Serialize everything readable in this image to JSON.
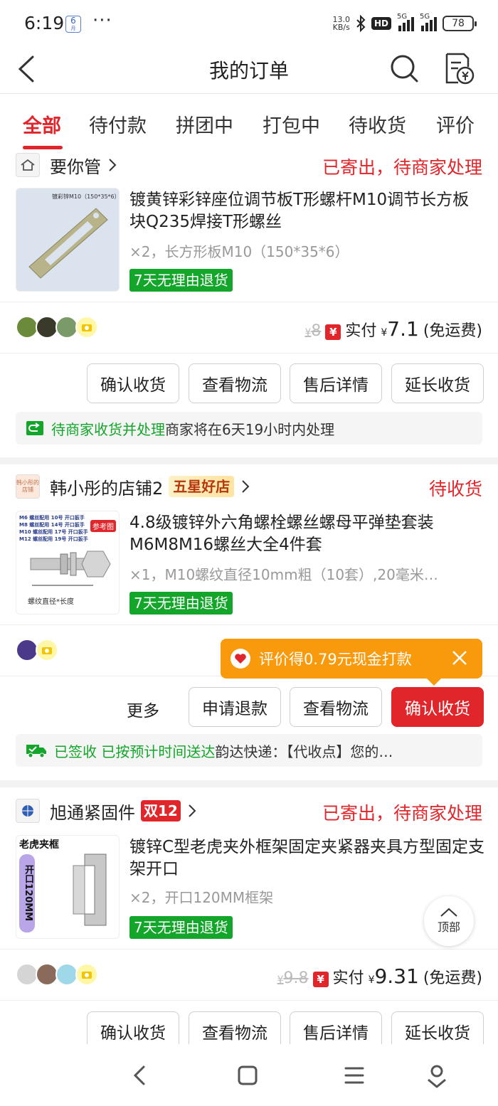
{
  "status_bar": {
    "time": "6:19",
    "badge_num": "6",
    "badge_sub": "月",
    "dots": "···",
    "net_speed_value": "13.0",
    "net_speed_unit": "KB/s",
    "hd": "HD",
    "net1": "5G",
    "net2": "5G",
    "battery": "78"
  },
  "header": {
    "title": "我的订单"
  },
  "tabs": [
    "全部",
    "待付款",
    "拼团中",
    "打包中",
    "待收货",
    "评价"
  ],
  "orders": [
    {
      "shop_name": "要你管",
      "shop_logo_text": "要你管",
      "status": "已寄出，待商家处理",
      "thumb_caption": "镀彩锌M10（150*35*6）",
      "product_title": "镀黄锌彩锌座位调节板T形螺杆M10调节长方板块Q235焊接T形螺丝",
      "spec": "×2，长方形板M10（150*35*6）",
      "return_badge": "7天无理由退货",
      "price_orig_symbol": "¥",
      "price_orig": "8",
      "paid_label": "实付",
      "paid_symbol": "¥",
      "paid_amount": "7.1",
      "shipping": "(免运费)",
      "buttons": [
        "确认收货",
        "查看物流",
        "售后详情",
        "延长收货"
      ],
      "notice_green": "待商家收货并处理",
      "notice_text": " 商家将在6天19小时内处理"
    },
    {
      "shop_name": "韩小彤的店铺2",
      "shop_logo_text": "韩小彤的店铺",
      "shop_tag": "五星好店",
      "status": "待收货",
      "thumb_tag": "参考图",
      "thumb_lines": [
        "M6 螺丝配用 10号 开口扳手",
        "M8 螺丝配用 14号 开口扳手",
        "M10 螺丝配用 17号 开口扳手",
        "M12 螺丝配用 19号 开口扳手"
      ],
      "thumb_bottom": "螺纹直径*长度",
      "product_title": "4.8级镀锌外六角螺栓螺丝螺母平弹垫套装M6M8M16螺丝大全4件套",
      "spec": "×1，M10螺纹直径10mm粗（10套）,20毫米…",
      "return_badge": "7天无理由退货",
      "tooltip": "评价得0.79元现金打款",
      "more": "更多",
      "buttons": [
        "申请退款",
        "查看物流",
        "确认收货"
      ],
      "notice_green": "已签收 已按预计时间送达",
      "notice_text": " 韵达快递：【代收点】您的…"
    },
    {
      "shop_name": "旭通紧固件",
      "shop_logo_text": "旭通",
      "shop_tag": "双12",
      "status": "已寄出，待商家处理",
      "thumb_title": "老虎夹框",
      "thumb_side": "开口120MM",
      "product_title": "镀锌C型老虎夹外框架固定夹紧器夹具方型固定支架开口",
      "spec": "×2，开口120MM框架",
      "return_badge": "7天无理由退货",
      "price_orig_symbol": "¥",
      "price_orig": "9.8",
      "paid_label": "实付",
      "paid_symbol": "¥",
      "paid_amount": "9.31",
      "shipping": "(免运费)",
      "buttons": [
        "确认收货",
        "查看物流",
        "售后详情",
        "延长收货"
      ]
    }
  ],
  "top_button": "顶部",
  "colors": {
    "accent": "#e0262b",
    "green": "#14a52b",
    "tooltip": "#f99a0c"
  }
}
